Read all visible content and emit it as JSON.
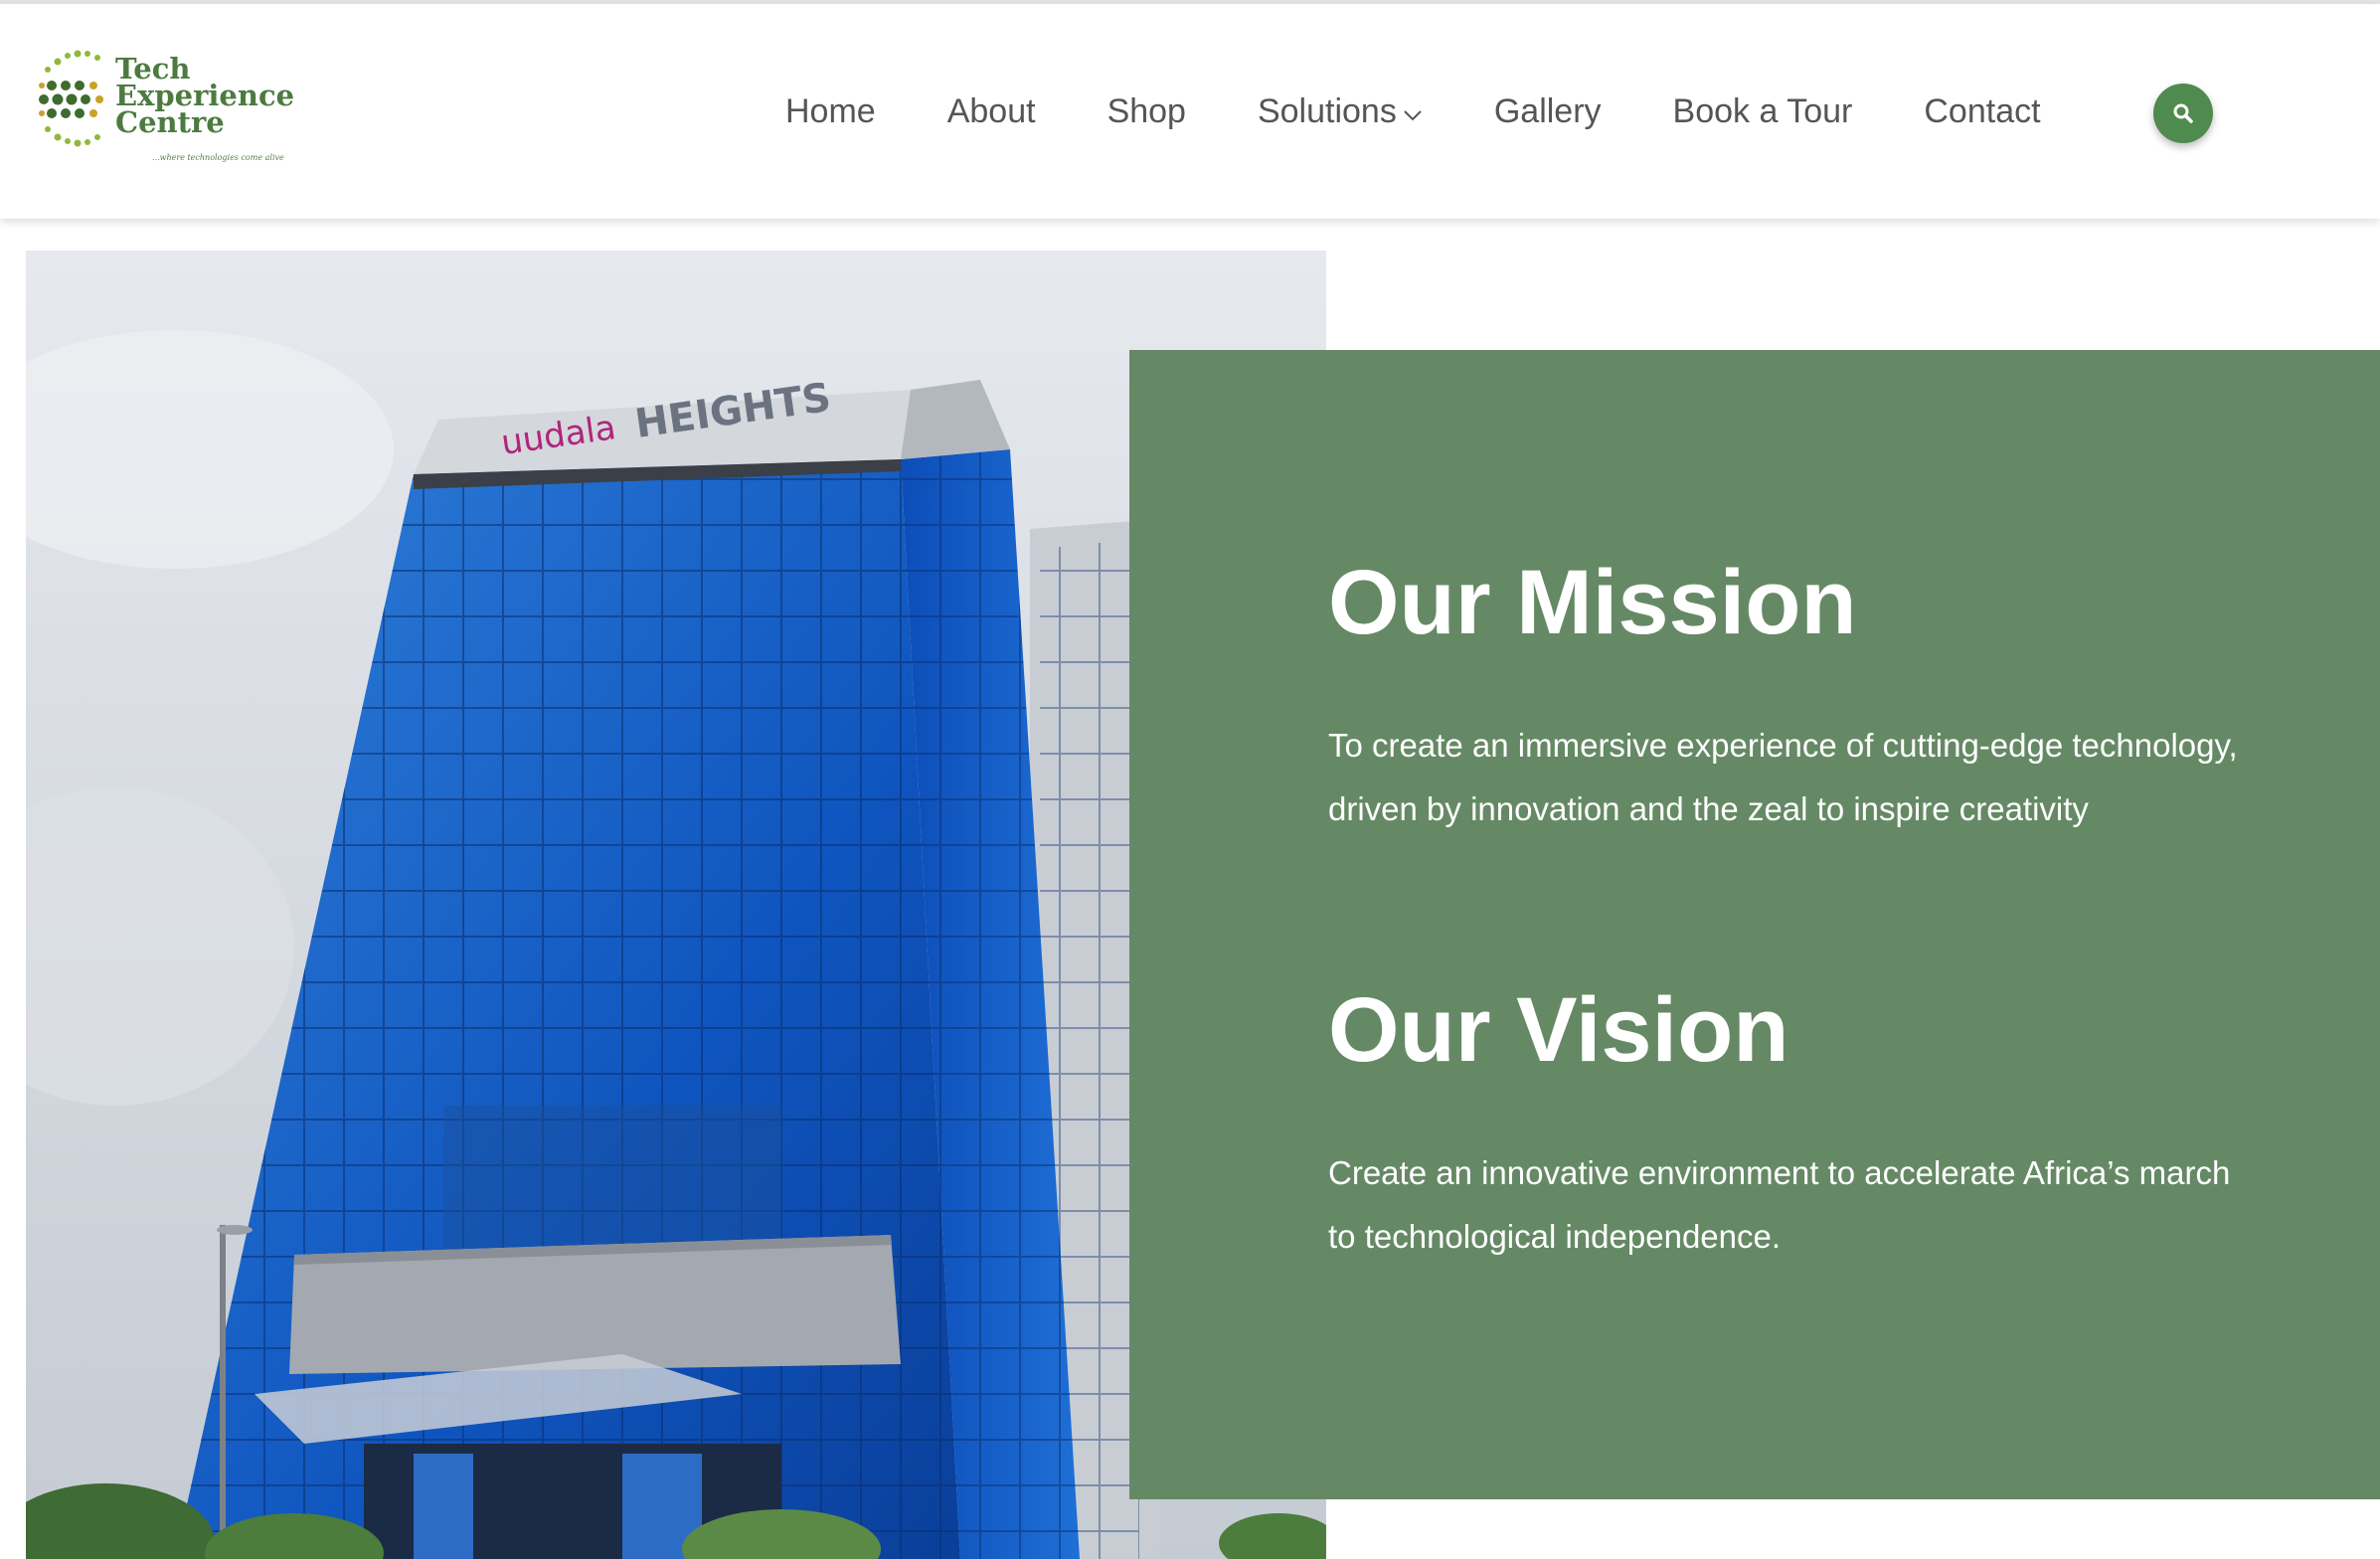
{
  "brand": {
    "logo_line1": "Tech",
    "logo_line2": "Experience",
    "logo_line3": "Centre",
    "tagline": "...where technologies come alive",
    "primary_color": "#4f8a4e",
    "panel_color": "#658965"
  },
  "nav": {
    "items": [
      {
        "label": "Home"
      },
      {
        "label": "About"
      },
      {
        "label": "Shop"
      },
      {
        "label": "Solutions"
      },
      {
        "label": "Gallery"
      },
      {
        "label": "Book a Tour"
      },
      {
        "label": "Contact"
      }
    ],
    "search_icon": "search-icon"
  },
  "photo": {
    "sign_left": "uudala",
    "sign_right": "HEIGHTS"
  },
  "mission": {
    "heading": "Our Mission",
    "text": "To create an immersive experience of cutting-edge technology, driven by innovation and the zeal to inspire creativity"
  },
  "vision": {
    "heading": "Our Vision",
    "text": "Create an innovative environment to accelerate Africa’s march to technological independence."
  }
}
